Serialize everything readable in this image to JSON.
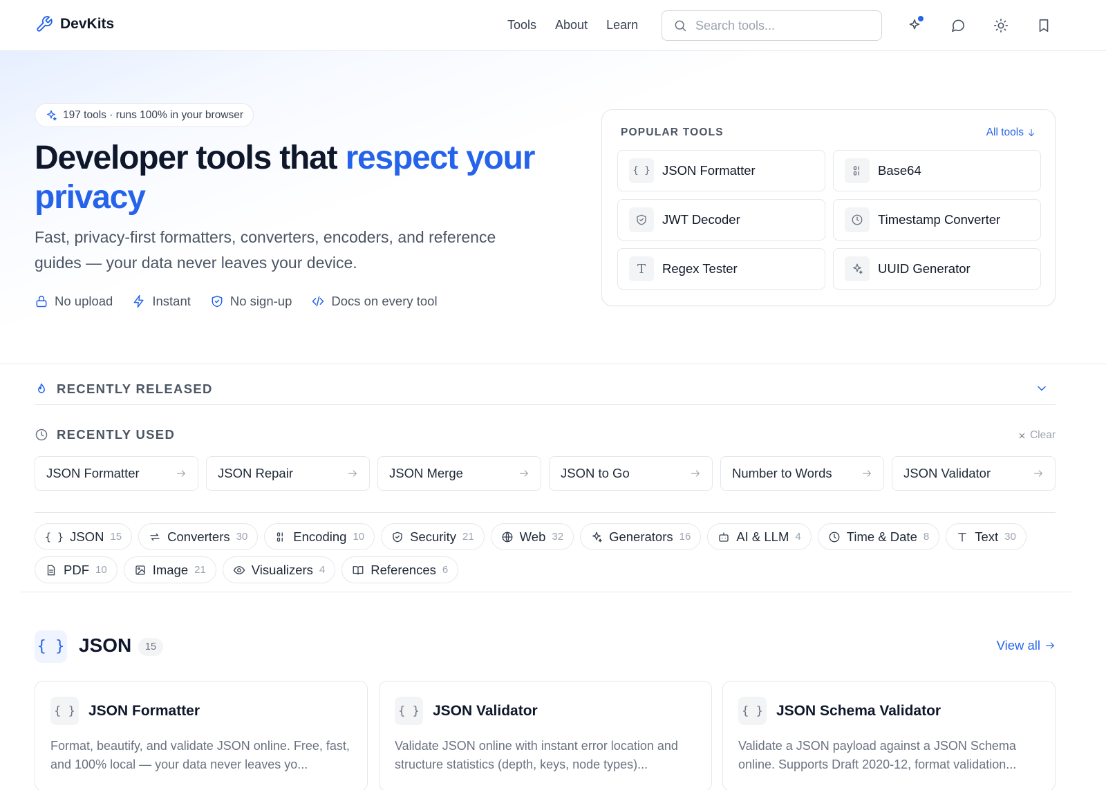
{
  "brand": {
    "name": "DevKits"
  },
  "nav": {
    "tools": "Tools",
    "about": "About",
    "learn": "Learn"
  },
  "search": {
    "placeholder": "Search tools..."
  },
  "hero": {
    "badge": "197 tools · runs 100% in your browser",
    "title_plain": "Developer tools that ",
    "title_accent": "respect your privacy",
    "subtitle": "Fast, privacy-first formatters, converters, encoders, and reference guides — your data never leaves your device.",
    "features": [
      "No upload",
      "Instant",
      "No sign-up",
      "Docs on every tool"
    ]
  },
  "popular": {
    "heading": "POPULAR TOOLS",
    "all_link": "All tools",
    "tools": [
      {
        "label": "JSON Formatter",
        "icon": "{ }"
      },
      {
        "label": "Base64",
        "icon": "binary-icon"
      },
      {
        "label": "JWT Decoder",
        "icon": "shield-icon"
      },
      {
        "label": "Timestamp Converter",
        "icon": "clock-icon"
      },
      {
        "label": "Regex Tester",
        "icon": "T"
      },
      {
        "label": "UUID Generator",
        "icon": "sparkle-icon"
      }
    ]
  },
  "recently_released": {
    "title": "RECENTLY RELEASED"
  },
  "recently_used": {
    "title": "RECENTLY USED",
    "clear": "Clear",
    "items": [
      "JSON Formatter",
      "JSON Repair",
      "JSON Merge",
      "JSON to Go",
      "Number to Words",
      "JSON Validator"
    ]
  },
  "categories": [
    {
      "label": "JSON",
      "count": "15",
      "icon": "braces-icon"
    },
    {
      "label": "Converters",
      "count": "30",
      "icon": "arrows-icon"
    },
    {
      "label": "Encoding",
      "count": "10",
      "icon": "binary-icon"
    },
    {
      "label": "Security",
      "count": "21",
      "icon": "shield-icon"
    },
    {
      "label": "Web",
      "count": "32",
      "icon": "globe-icon"
    },
    {
      "label": "Generators",
      "count": "16",
      "icon": "sparkle-icon"
    },
    {
      "label": "AI & LLM",
      "count": "4",
      "icon": "bot-icon"
    },
    {
      "label": "Time & Date",
      "count": "8",
      "icon": "clock-icon"
    },
    {
      "label": "Text",
      "count": "30",
      "icon": "type-icon"
    },
    {
      "label": "PDF",
      "count": "10",
      "icon": "file-icon"
    },
    {
      "label": "Image",
      "count": "21",
      "icon": "image-icon"
    },
    {
      "label": "Visualizers",
      "count": "4",
      "icon": "eye-icon"
    },
    {
      "label": "References",
      "count": "6",
      "icon": "book-icon"
    }
  ],
  "json_section": {
    "icon": "{ }",
    "title": "JSON",
    "count": "15",
    "view_all": "View all",
    "cards": [
      {
        "icon": "{ }",
        "title": "JSON Formatter",
        "desc": "Format, beautify, and validate JSON online. Free, fast, and 100% local — your data never leaves yo..."
      },
      {
        "icon": "{ }",
        "title": "JSON Validator",
        "desc": "Validate JSON online with instant error location and structure statistics (depth, keys, node types)..."
      },
      {
        "icon": "{ }",
        "title": "JSON Schema Validator",
        "desc": "Validate a JSON payload against a JSON Schema online. Supports Draft 2020-12, format validation..."
      }
    ]
  },
  "colors": {
    "accent": "#2563eb",
    "text": "#0f172a",
    "muted": "#6b7280",
    "border": "#e5e7eb"
  }
}
